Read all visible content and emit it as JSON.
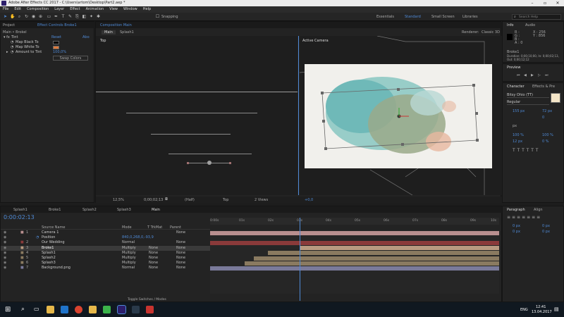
{
  "window": {
    "title": "Adobe After Effects CC 2017 - C:\\Users\\artom\\Desktop\\Part2.aep *"
  },
  "menu": [
    "File",
    "Edit",
    "Composition",
    "Layer",
    "Effect",
    "Animation",
    "View",
    "Window",
    "Help"
  ],
  "toolbar": {
    "snapping": "Snapping",
    "workspaces": [
      "Essentials",
      "Standard",
      "Small Screen",
      "Libraries"
    ],
    "search_placeholder": "Search Help"
  },
  "project": {
    "tab": "Project",
    "breadcrumb": "Main • Brokel"
  },
  "effect_controls": {
    "tab": "Effect Controls Broke1",
    "fx_name": "Tint",
    "reset": "Reset",
    "about": "Abo",
    "props": [
      {
        "label": "Map Black To"
      },
      {
        "label": "Map White To"
      },
      {
        "label": "Amount to Tint",
        "value": "100,0%"
      }
    ],
    "swap_button": "Swap Colors",
    "colors": {
      "black": "#000000",
      "white": "#e07a3a"
    }
  },
  "composition": {
    "tab": "Composition Main",
    "subtabs": [
      "Main",
      "Splash1"
    ],
    "renderer_label": "Renderer:",
    "renderer": "Classic 3D",
    "view_left": "Top",
    "view_right": "Active Camera"
  },
  "viewer_footer": {
    "zoom": "12,5%",
    "timecode": "0;00;02;13",
    "resolution": "(Half)",
    "view": "Top",
    "views": "2 Views",
    "plus": "+0,0"
  },
  "info_panel": {
    "tab": "Info",
    "audio_tab": "Audio",
    "layer": "Broke1",
    "duration": "Duration: 0;00;10;00, In: 0;00;02;13, Out: 0;00;12;12",
    "rgba": [
      "R :",
      "G :",
      "B :",
      "A : 0"
    ],
    "coords": [
      "X : 256",
      "Y : 856"
    ]
  },
  "preview": {
    "tab": "Preview"
  },
  "character": {
    "tab": "Character",
    "tab2": "Effects & Pre",
    "font": "Bitsy Ohio (TT)",
    "style": "Regular",
    "size": "155 px",
    "leading": "72 px",
    "tracking": "0",
    "unit": "px",
    "vscale": "100 %",
    "hscale": "100 %",
    "baseline": "12 px",
    "tsume": "0 %"
  },
  "paragraph": {
    "tab": "Paragraph",
    "align_tab": "Align",
    "indents": [
      "0 px",
      "0 px",
      "0 px",
      "0 px"
    ]
  },
  "timeline": {
    "tabs": [
      "Splash1",
      "Broke1",
      "Splash2",
      "Splash3",
      "Main"
    ],
    "timecode": "0:00:02:13",
    "columns": [
      "Source Name",
      "Mode",
      "T TrkMat",
      "Parent"
    ],
    "ruler": [
      "0:00s",
      "01s",
      "02s",
      "03s",
      "04s",
      "05s",
      "06s",
      "07s",
      "08s",
      "09s",
      "10s"
    ],
    "layers": [
      {
        "num": "1",
        "name": "Camera 1",
        "mode": "",
        "trk": "",
        "parent": "None",
        "bar": "#b88f8f",
        "start": 0,
        "end": 1
      },
      {
        "num": "",
        "name": "Position",
        "mode": "",
        "trk": "",
        "parent": "",
        "bar": "",
        "start": 0,
        "end": 0,
        "sub": true,
        "value": "840,0,268,0,-93,9"
      },
      {
        "num": "2",
        "name": "Our Wedding",
        "mode": "Normal",
        "trk": "",
        "parent": "None",
        "bar": "#8a3a3a",
        "start": 0,
        "end": 1
      },
      {
        "num": "3",
        "name": "Broke1",
        "mode": "Multiply",
        "trk": "None",
        "parent": "None",
        "bar": "#b89a80",
        "start": 0.31,
        "end": 1,
        "selected": true
      },
      {
        "num": "4",
        "name": "Splash1",
        "mode": "Multiply",
        "trk": "None",
        "parent": "None",
        "bar": "#8a7a60",
        "start": 0.2,
        "end": 1
      },
      {
        "num": "5",
        "name": "Splash2",
        "mode": "Multiply",
        "trk": "None",
        "parent": "None",
        "bar": "#8a7a60",
        "start": 0.15,
        "end": 1
      },
      {
        "num": "6",
        "name": "Splash3",
        "mode": "Multiply",
        "trk": "None",
        "parent": "None",
        "bar": "#8a7a60",
        "start": 0.12,
        "end": 1
      },
      {
        "num": "7",
        "name": "Background.png",
        "mode": "Normal",
        "trk": "None",
        "parent": "None",
        "bar": "#7a7a9a",
        "start": 0,
        "end": 1
      }
    ],
    "footer": "Toggle Switches / Modes",
    "playhead": 0.31
  },
  "taskbar": {
    "time": "12:41",
    "date": "13.04.2017",
    "lang": "ENG"
  },
  "colors": {
    "accent": "#4f8ad6",
    "panel": "#232323",
    "dark": "#1d1d1d"
  }
}
